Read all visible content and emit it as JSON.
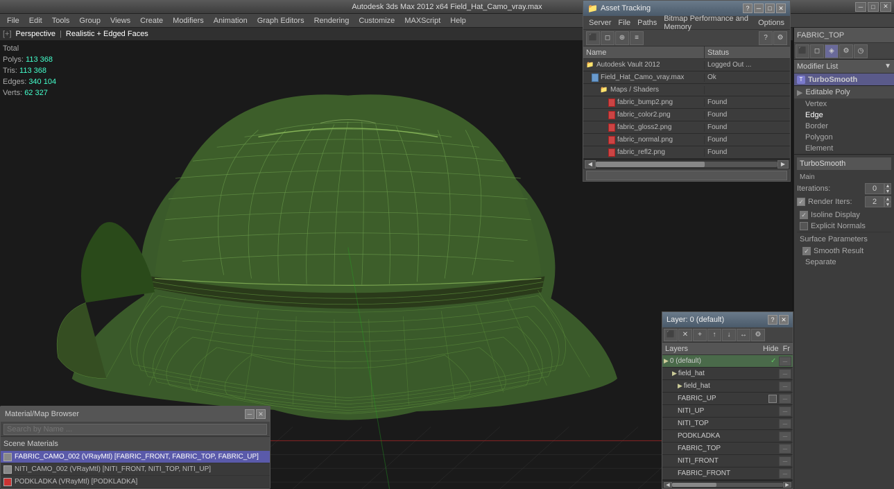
{
  "titlebar": {
    "title": "Autodesk 3ds Max 2012 x64        Field_Hat_Camo_vray.max"
  },
  "menubar": {
    "items": [
      "Edit",
      "Tools",
      "Group",
      "Views",
      "Create",
      "Modifiers",
      "Animation",
      "Graph Editors",
      "Rendering",
      "Customize",
      "MAXScript",
      "Help"
    ]
  },
  "viewport": {
    "label": "[+]",
    "perspective": "Perspective",
    "mode": "Realistic + Edged Faces",
    "stats": {
      "total": "Total",
      "polys_label": "Polys:",
      "polys_val": "113 368",
      "tris_label": "Tris:",
      "tris_val": "113 368",
      "edges_label": "Edges:",
      "edges_val": "340 104",
      "verts_label": "Verts:",
      "verts_val": "62 327"
    }
  },
  "asset_tracking": {
    "title": "Asset Tracking",
    "menu": [
      "Server",
      "File",
      "Paths",
      "Bitmap Performance and Memory",
      "Options"
    ],
    "col_name": "Name",
    "col_status": "Status",
    "rows": [
      {
        "indent": 0,
        "icon": "folder",
        "name": "Autodesk Vault 2012",
        "status": "Logged Out ..."
      },
      {
        "indent": 1,
        "icon": "file-blue",
        "name": "Field_Hat_Camo_vray.max",
        "status": "Ok"
      },
      {
        "indent": 2,
        "icon": "folder",
        "name": "Maps / Shaders",
        "status": ""
      },
      {
        "indent": 3,
        "icon": "file-red",
        "name": "fabric_bump2.png",
        "status": "Found"
      },
      {
        "indent": 3,
        "icon": "file-red",
        "name": "fabric_color2.png",
        "status": "Found"
      },
      {
        "indent": 3,
        "icon": "file-red",
        "name": "fabric_gloss2.png",
        "status": "Found"
      },
      {
        "indent": 3,
        "icon": "file-red",
        "name": "fabric_normal.png",
        "status": "Found"
      },
      {
        "indent": 3,
        "icon": "file-red",
        "name": "fabric_refl2.png",
        "status": "Found"
      }
    ]
  },
  "right_panel": {
    "top_label": "FABRIC_TOP",
    "modifier_list_label": "Modifier List",
    "turbosmooth_label": "TurboSmooth",
    "editable_poly_label": "Editable Poly",
    "ep_items": [
      "Vertex",
      "Edge",
      "Border",
      "Polygon",
      "Element"
    ],
    "ts_panel_label": "TurboSmooth",
    "ts_main_label": "Main",
    "iterations_label": "Iterations:",
    "iterations_val": "0",
    "render_iters_label": "Render Iters:",
    "render_iters_val": "2",
    "isoline_display_label": "Isoline Display",
    "explicit_normals_label": "Explicit Normals",
    "surface_params_label": "Surface Parameters",
    "smooth_result_label": "Smooth Result",
    "separate_label": "Separate"
  },
  "layers_panel": {
    "title": "Layer: 0 (default)",
    "col_layers": "Layers",
    "col_hide": "Hide",
    "col_fr": "Fr",
    "rows": [
      {
        "name": "0 (default)",
        "active": true,
        "checked": true,
        "indent": 0
      },
      {
        "name": "field_hat",
        "active": false,
        "checked": false,
        "indent": 1
      },
      {
        "name": "field_hat",
        "active": false,
        "checked": false,
        "indent": 2
      },
      {
        "name": "FABRIC_UP",
        "active": false,
        "checked": false,
        "indent": 2
      },
      {
        "name": "NITI_UP",
        "active": false,
        "checked": false,
        "indent": 2
      },
      {
        "name": "NITI_TOP",
        "active": false,
        "checked": false,
        "indent": 2
      },
      {
        "name": "PODKLADKA",
        "active": false,
        "checked": false,
        "indent": 2
      },
      {
        "name": "FABRIC_TOP",
        "active": false,
        "checked": false,
        "indent": 2
      },
      {
        "name": "NITI_FRONT",
        "active": false,
        "checked": false,
        "indent": 2
      },
      {
        "name": "FABRIC_FRONT",
        "active": false,
        "checked": false,
        "indent": 2
      }
    ]
  },
  "material_panel": {
    "title": "Material/Map Browser",
    "search_placeholder": "Search by Name ...",
    "scene_materials_label": "Scene Materials",
    "materials": [
      {
        "name": "FABRIC_CAMO_002 (VRayMtl) [FABRIC_FRONT, FABRIC_TOP, FABRIC_UP]",
        "swatch": "gray",
        "highlighted": true
      },
      {
        "name": "NITI_CAMO_002 (VRayMtl) [NITI_FRONT, NITI_TOP, NITI_UP]",
        "swatch": "gray",
        "highlighted": false
      },
      {
        "name": "PODKLADKA (VRayMtl) [PODKLADKA]",
        "swatch": "red",
        "highlighted": false
      }
    ]
  }
}
